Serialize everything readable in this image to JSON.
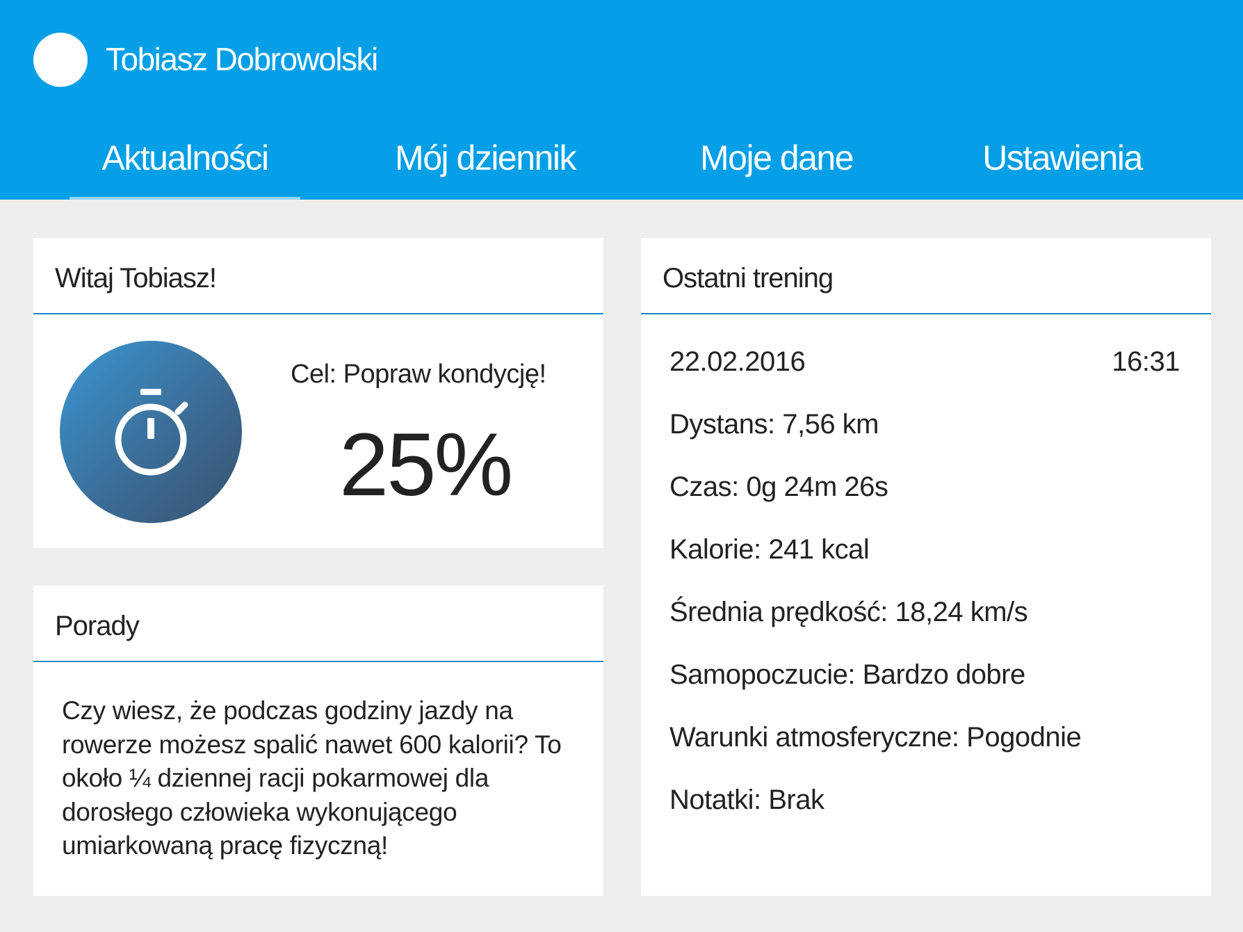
{
  "user": {
    "name": "Tobiasz Dobrowolski"
  },
  "tabs": [
    {
      "label": "Aktualności",
      "active": true
    },
    {
      "label": "Mój dziennik",
      "active": false
    },
    {
      "label": "Moje dane",
      "active": false
    },
    {
      "label": "Ustawienia",
      "active": false
    }
  ],
  "welcome": {
    "title": "Witaj Tobiasz!",
    "icon": "stopwatch-icon",
    "goal_label": "Cel: Popraw kondycję!",
    "goal_progress": "25%"
  },
  "tips": {
    "title": "Porady",
    "text": "Czy wiesz, że podczas godziny jazdy na rowerze możesz spalić nawet 600 kalorii? To około ¼ dziennej racji pokarmowej dla dorosłego człowieka wykonującego umiarkowaną pracę fizyczną!"
  },
  "training": {
    "title": "Ostatni trening",
    "date": "22.02.2016",
    "time": "16:31",
    "rows": [
      "Dystans: 7,56 km",
      "Czas: 0g 24m 26s",
      "Kalorie: 241 kcal",
      "Średnia prędkość: 18,24 km/s",
      "Samopoczucie: Bardzo dobre",
      "Warunki atmosferyczne: Pogodnie",
      "Notatki: Brak"
    ]
  },
  "colors": {
    "header": "#049fe6",
    "accent_line": "#1f86c7",
    "background": "#eeeeee"
  }
}
